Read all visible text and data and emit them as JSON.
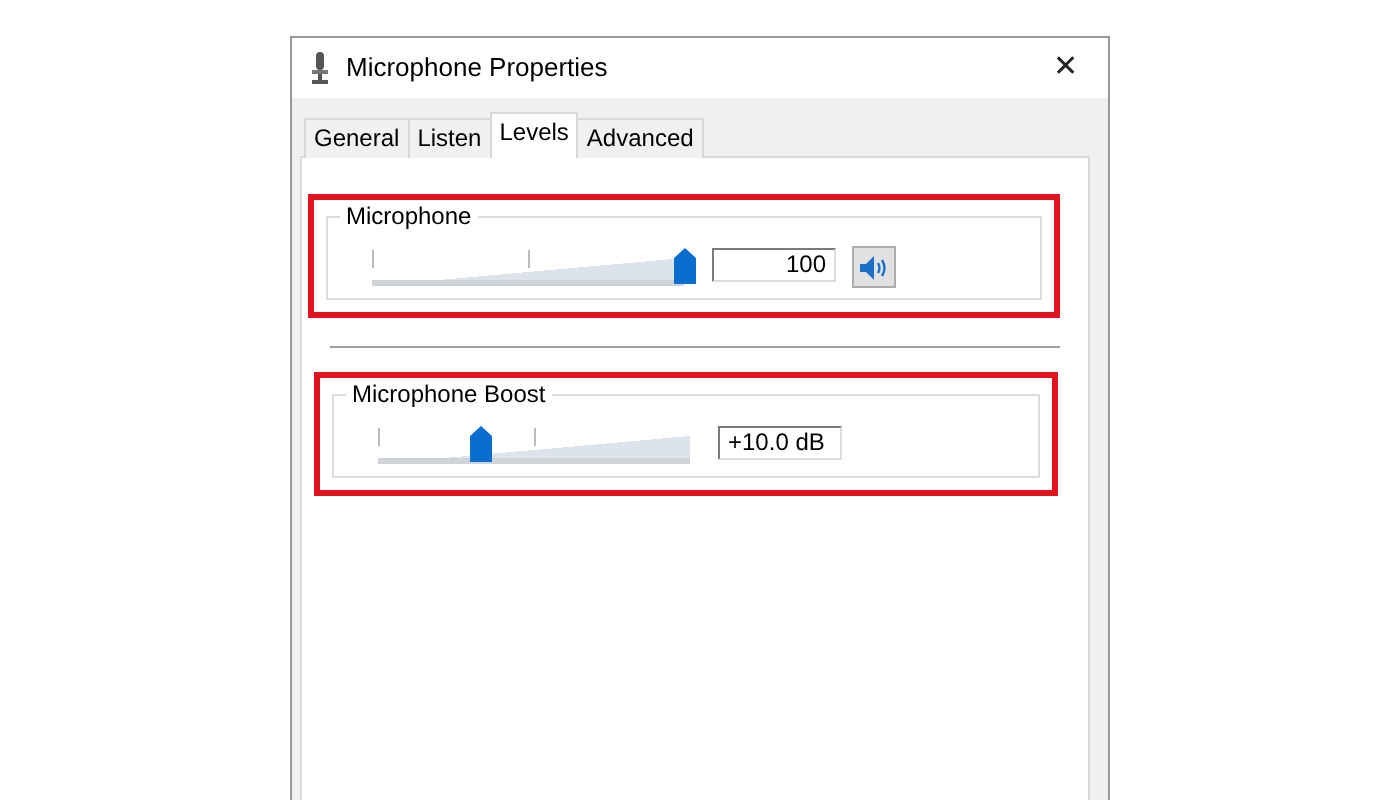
{
  "window": {
    "title": "Microphone Properties",
    "close": "✕"
  },
  "tabs": [
    {
      "label": "General",
      "selected": false
    },
    {
      "label": "Listen",
      "selected": false
    },
    {
      "label": "Levels",
      "selected": true
    },
    {
      "label": "Advanced",
      "selected": false
    }
  ],
  "groups": [
    {
      "label": "Microphone",
      "highlighted": true,
      "level": 1.0,
      "reading": "100",
      "mute_button": true
    },
    {
      "label": "Microphone Boost",
      "highlighted": true,
      "level": 0.33,
      "reading": "+10.0 dB",
      "mute_button": false
    }
  ]
}
